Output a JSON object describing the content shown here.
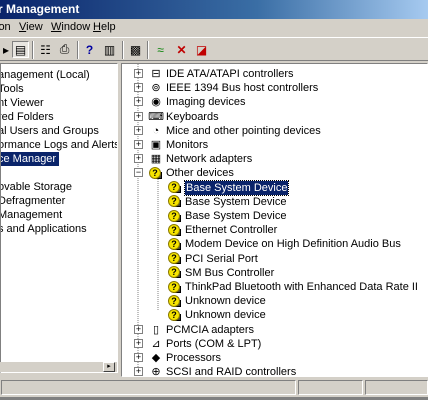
{
  "window": {
    "title": "r Management"
  },
  "menu": [
    {
      "pre": "",
      "u": "",
      "post": "ion"
    },
    {
      "pre": "",
      "u": "V",
      "post": "iew"
    },
    {
      "pre": "",
      "u": "W",
      "post": "indow"
    },
    {
      "pre": "",
      "u": "H",
      "post": "elp"
    }
  ],
  "toolbar": {
    "buttons": [
      "back-icon",
      "show-hide-tree-icon",
      "properties-icon",
      "print-icon",
      "help-icon",
      "console-icon",
      "scan-hardware-icon",
      "update-driver-icon",
      "uninstall-icon",
      "disable-icon"
    ]
  },
  "left_tree": [
    {
      "label": "anagement (Local)",
      "selected": false
    },
    {
      "label": "Tools",
      "selected": false
    },
    {
      "label": "nt Viewer",
      "selected": false
    },
    {
      "label": "red Folders",
      "selected": false
    },
    {
      "label": "al Users and Groups",
      "selected": false
    },
    {
      "label": "ormance Logs and Alerts",
      "selected": false
    },
    {
      "label": "ce Manager",
      "selected": true
    },
    {
      "label": "",
      "selected": false
    },
    {
      "label": "ovable Storage",
      "selected": false
    },
    {
      "label": "Defragmenter",
      "selected": false
    },
    {
      "label": "Management",
      "selected": false
    },
    {
      "label": "s and Applications",
      "selected": false
    }
  ],
  "devices": [
    {
      "label": "IDE ATA/ATAPI controllers",
      "level": 0,
      "expander": "+",
      "icon": "ide-controller-icon",
      "glyph": "⊟",
      "warning": false,
      "selected": false
    },
    {
      "label": "IEEE 1394 Bus host controllers",
      "level": 0,
      "expander": "+",
      "icon": "ieee1394-icon",
      "glyph": "⊚",
      "warning": false,
      "selected": false
    },
    {
      "label": "Imaging devices",
      "level": 0,
      "expander": "+",
      "icon": "camera-icon",
      "glyph": "◉",
      "warning": false,
      "selected": false
    },
    {
      "label": "Keyboards",
      "level": 0,
      "expander": "+",
      "icon": "keyboard-icon",
      "glyph": "⌨",
      "warning": false,
      "selected": false
    },
    {
      "label": "Mice and other pointing devices",
      "level": 0,
      "expander": "+",
      "icon": "mouse-icon",
      "glyph": "◔",
      "warning": false,
      "selected": false
    },
    {
      "label": "Monitors",
      "level": 0,
      "expander": "+",
      "icon": "monitor-icon",
      "glyph": "▣",
      "warning": false,
      "selected": false
    },
    {
      "label": "Network adapters",
      "level": 0,
      "expander": "+",
      "icon": "network-adapter-icon",
      "glyph": "▦",
      "warning": false,
      "selected": false
    },
    {
      "label": "Other devices",
      "level": 0,
      "expander": "-",
      "icon": "other-devices-icon",
      "glyph": "",
      "warning": true,
      "selected": false
    },
    {
      "label": "Base System Device",
      "level": 1,
      "expander": "",
      "icon": "unknown-device-icon",
      "glyph": "",
      "warning": true,
      "selected": true
    },
    {
      "label": "Base System Device",
      "level": 1,
      "expander": "",
      "icon": "unknown-device-icon",
      "glyph": "",
      "warning": true,
      "selected": false
    },
    {
      "label": "Base System Device",
      "level": 1,
      "expander": "",
      "icon": "unknown-device-icon",
      "glyph": "",
      "warning": true,
      "selected": false
    },
    {
      "label": "Ethernet Controller",
      "level": 1,
      "expander": "",
      "icon": "unknown-device-icon",
      "glyph": "",
      "warning": true,
      "selected": false
    },
    {
      "label": "Modem Device on High Definition Audio Bus",
      "level": 1,
      "expander": "",
      "icon": "unknown-device-icon",
      "glyph": "",
      "warning": true,
      "selected": false
    },
    {
      "label": "PCI Serial Port",
      "level": 1,
      "expander": "",
      "icon": "unknown-device-icon",
      "glyph": "",
      "warning": true,
      "selected": false
    },
    {
      "label": "SM Bus Controller",
      "level": 1,
      "expander": "",
      "icon": "unknown-device-icon",
      "glyph": "",
      "warning": true,
      "selected": false
    },
    {
      "label": "ThinkPad Bluetooth with Enhanced Data Rate II",
      "level": 1,
      "expander": "",
      "icon": "unknown-device-icon",
      "glyph": "",
      "warning": true,
      "selected": false
    },
    {
      "label": "Unknown device",
      "level": 1,
      "expander": "",
      "icon": "unknown-device-icon",
      "glyph": "",
      "warning": true,
      "selected": false
    },
    {
      "label": "Unknown device",
      "level": 1,
      "expander": "",
      "icon": "unknown-device-icon",
      "glyph": "",
      "warning": true,
      "selected": false
    },
    {
      "label": "PCMCIA adapters",
      "level": 0,
      "expander": "+",
      "icon": "pcmcia-icon",
      "glyph": "▯",
      "warning": false,
      "selected": false
    },
    {
      "label": "Ports (COM & LPT)",
      "level": 0,
      "expander": "+",
      "icon": "port-icon",
      "glyph": "⊿",
      "warning": false,
      "selected": false
    },
    {
      "label": "Processors",
      "level": 0,
      "expander": "+",
      "icon": "processor-icon",
      "glyph": "◆",
      "warning": false,
      "selected": false
    },
    {
      "label": "SCSI and RAID controllers",
      "level": 0,
      "expander": "+",
      "icon": "scsi-controller-icon",
      "glyph": "⊕",
      "warning": false,
      "selected": false
    }
  ]
}
